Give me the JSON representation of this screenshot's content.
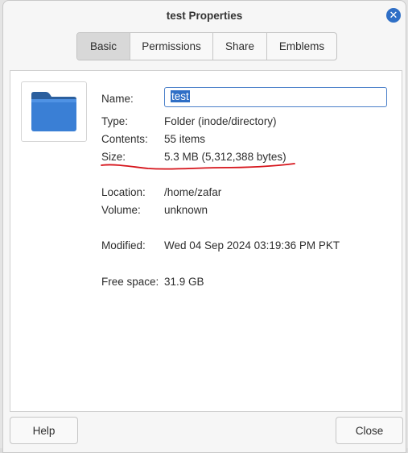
{
  "window": {
    "title": "test Properties",
    "close_glyph": "✕"
  },
  "tabs": [
    {
      "label": "Basic",
      "active": true
    },
    {
      "label": "Permissions",
      "active": false
    },
    {
      "label": "Share",
      "active": false
    },
    {
      "label": "Emblems",
      "active": false
    }
  ],
  "icon": {
    "name": "folder-icon",
    "color": "#3a7fd5"
  },
  "fields": {
    "name_label": "Name:",
    "name_value": "test",
    "type_label": "Type:",
    "type_value": "Folder (inode/directory)",
    "contents_label": "Contents:",
    "contents_value": "55 items",
    "size_label": "Size:",
    "size_value": "5.3 MB (5,312,388 bytes)",
    "location_label": "Location:",
    "location_value": "/home/zafar",
    "volume_label": "Volume:",
    "volume_value": "unknown",
    "modified_label": "Modified:",
    "modified_value": "Wed 04 Sep 2024 03:19:36 PM PKT",
    "freespace_label": "Free space:",
    "freespace_value": "31.9 GB"
  },
  "annotation": {
    "underline_color": "#d6141b"
  },
  "footer": {
    "help_label": "Help",
    "close_label": "Close"
  }
}
